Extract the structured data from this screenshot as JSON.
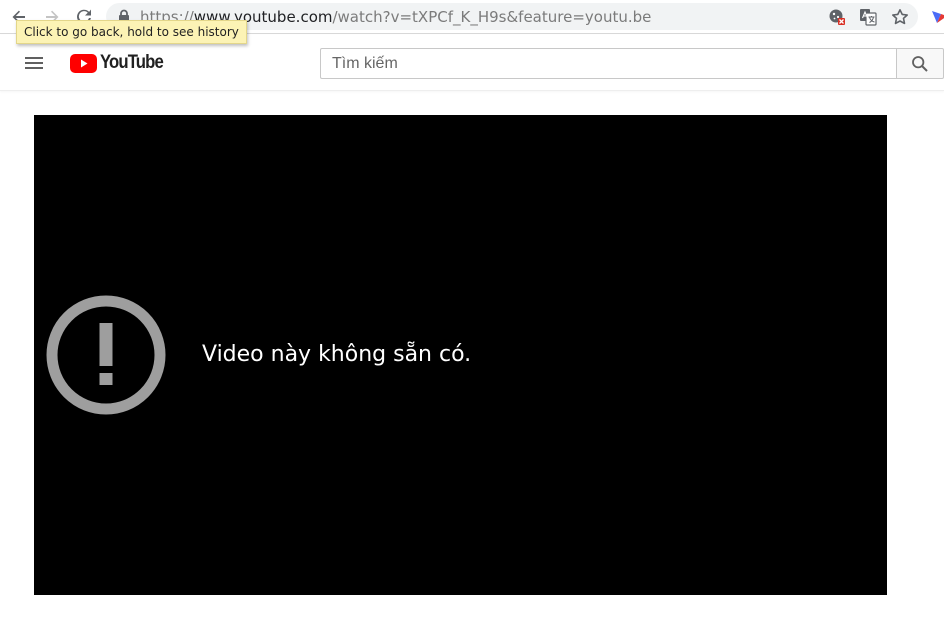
{
  "browser": {
    "url_scheme": "https://",
    "url_host": "www.youtube.com",
    "url_path": "/watch?v=tXPCf_K_H9s&feature=youtu.be",
    "tooltip": "Click to go back, hold to see history"
  },
  "masthead": {
    "logo_text": "YouTube",
    "search_placeholder": "Tìm kiếm"
  },
  "player": {
    "error_message": "Video này không sẵn có."
  },
  "colors": {
    "youtube_red": "#ff0000",
    "player_bg": "#000000",
    "error_icon": "#9e9e9e"
  }
}
